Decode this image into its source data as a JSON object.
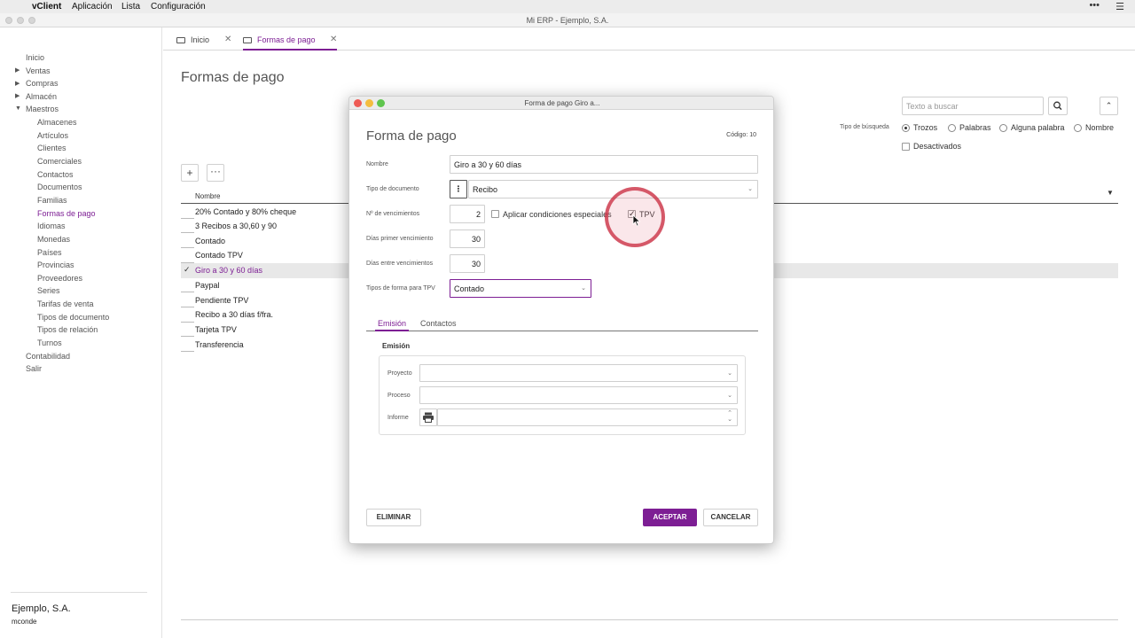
{
  "menubar": {
    "app": "vClient",
    "items": [
      "Aplicación",
      "Lista",
      "Configuración"
    ]
  },
  "window": {
    "title": "Mi ERP - Ejemplo, S.A."
  },
  "sidebar": {
    "items": [
      {
        "label": "Inicio"
      },
      {
        "label": "Ventas"
      },
      {
        "label": "Compras"
      },
      {
        "label": "Almacén"
      },
      {
        "label": "Maestros"
      },
      {
        "label": "Almacenes"
      },
      {
        "label": "Artículos"
      },
      {
        "label": "Clientes"
      },
      {
        "label": "Comerciales"
      },
      {
        "label": "Contactos"
      },
      {
        "label": "Documentos"
      },
      {
        "label": "Familias"
      },
      {
        "label": "Formas de pago"
      },
      {
        "label": "Idiomas"
      },
      {
        "label": "Monedas"
      },
      {
        "label": "Países"
      },
      {
        "label": "Provincias"
      },
      {
        "label": "Proveedores"
      },
      {
        "label": "Series"
      },
      {
        "label": "Tarifas de venta"
      },
      {
        "label": "Tipos de documento"
      },
      {
        "label": "Tipos de relación"
      },
      {
        "label": "Turnos"
      },
      {
        "label": "Contabilidad"
      },
      {
        "label": "Salir"
      }
    ],
    "company": "Ejemplo, S.A.",
    "user": "mconde"
  },
  "tabs": [
    {
      "label": "Inicio"
    },
    {
      "label": "Formas de pago"
    }
  ],
  "page": {
    "title": "Formas de pago",
    "search_placeholder": "Texto a buscar",
    "search_type_label": "Tipo de búsqueda",
    "search_types": [
      "Trozos",
      "Palabras",
      "Alguna palabra",
      "Nombre"
    ],
    "deactivated_label": "Desactivados",
    "column_header": "Nombre",
    "rows": [
      "20% Contado y 80% cheque",
      "3 Recibos a 30,60 y 90",
      "Contado",
      "Contado TPV",
      "Giro a 30 y 60 días",
      "Paypal",
      "Pendiente TPV",
      "Recibo a 30 días f/fra.",
      "Tarjeta TPV",
      "Transferencia"
    ],
    "selected_row": "Giro a 30 y 60 días"
  },
  "dialog": {
    "window_title": "Forma de pago Giro a...",
    "heading": "Forma de pago",
    "codigo": "Código: 10",
    "fields": {
      "nombre_label": "Nombre",
      "nombre_value": "Giro a 30 y 60 días",
      "tipo_doc_label": "Tipo de documento",
      "tipo_doc_value": "Recibo",
      "n_venc_label": "Nº de vencimientos",
      "n_venc_value": "2",
      "aplicar_label": "Aplicar condiciones especiales",
      "tpv_label": "TPV",
      "dias_primer_label": "Días primer vencimiento",
      "dias_primer_value": "30",
      "dias_entre_label": "Días entre vencimientos",
      "dias_entre_value": "30",
      "tipos_tpv_label": "Tipos de forma para TPV",
      "tipos_tpv_value": "Contado"
    },
    "tabs": [
      "Emisión",
      "Contactos"
    ],
    "section_title": "Emisión",
    "group_labels": [
      "Proyecto",
      "Proceso",
      "Informe"
    ],
    "buttons": {
      "eliminar": "ELIMINAR",
      "aceptar": "ACEPTAR",
      "cancelar": "CANCELAR"
    }
  },
  "colors": {
    "accent": "#7d1e94",
    "highlight_ring": "#c8283c"
  }
}
